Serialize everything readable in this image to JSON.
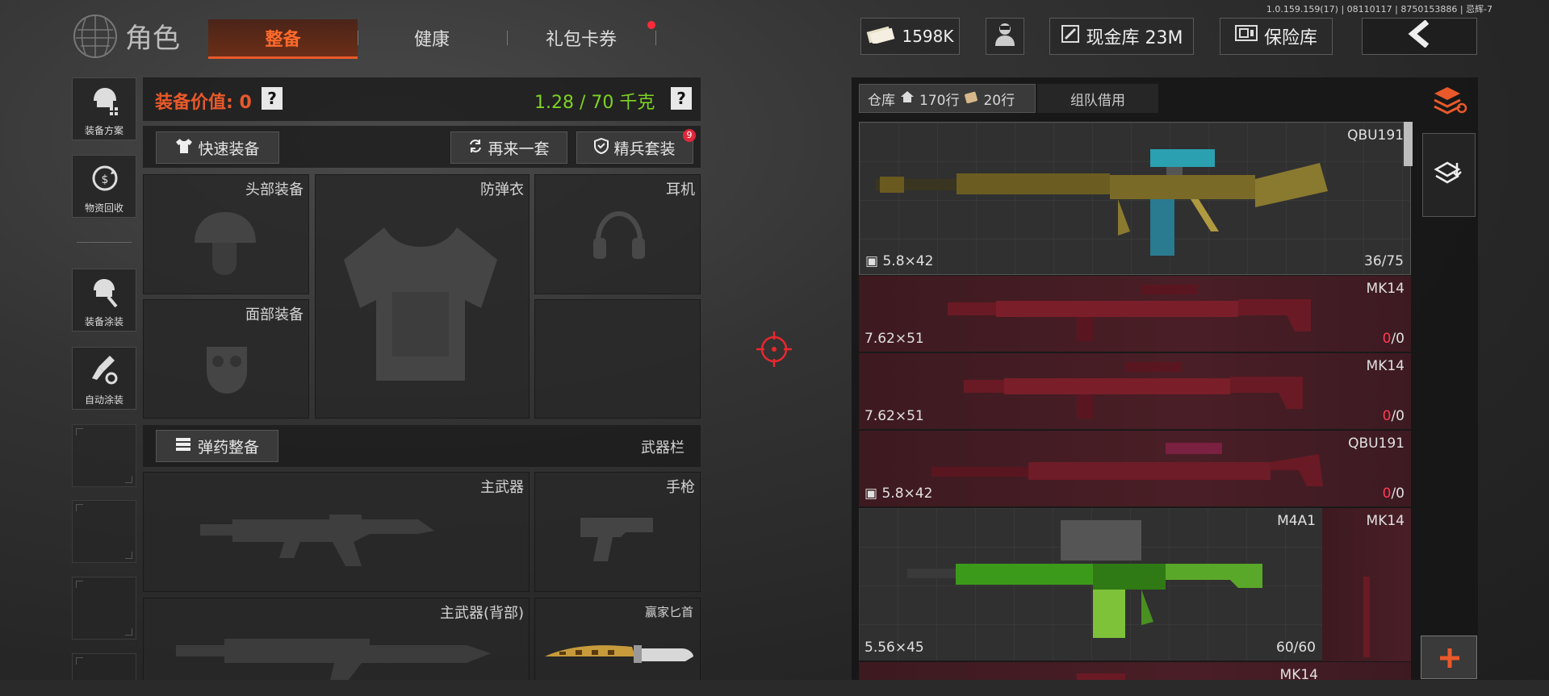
{
  "version": "1.0.159.159(17) | 08110117 | 8750153886 | 忌辉-7",
  "header": {
    "title": "角色",
    "tabs": [
      {
        "label": "整备",
        "active": true
      },
      {
        "label": "健康",
        "active": false
      },
      {
        "label": "礼包卡券",
        "active": false
      }
    ],
    "currency": "1598K",
    "cash_vault": "现金库 23M",
    "safe_vault": "保险库"
  },
  "sidebar": {
    "items": [
      {
        "label": "装备方案",
        "icon": "loadout-icon"
      },
      {
        "label": "物资回收",
        "icon": "recycle-icon"
      },
      {
        "label": "装备涂装",
        "icon": "skin-icon"
      },
      {
        "label": "自动涂装",
        "icon": "auto-paint-icon"
      }
    ]
  },
  "equipment": {
    "value_label": "装备价值: 0",
    "help": "?",
    "weight": "1.28 / 70 千克",
    "quick_equip": "快速装备",
    "again": "再来一套",
    "elite": "精兵套装",
    "elite_badge": "9",
    "slots": {
      "head": "头部装备",
      "armor": "防弹衣",
      "headset": "耳机",
      "face": "面部装备",
      "primary": "主武器",
      "pistol": "手枪",
      "primary_back": "主武器(背部)",
      "knife": "赢家匕首"
    },
    "ammo_button": "弹药整备",
    "weapon_bar": "武器栏"
  },
  "storage": {
    "tab_warehouse": "仓库",
    "rows_home": "170行",
    "rows_bag": "20行",
    "tab_team": "组队借用",
    "items": [
      {
        "name": "QBU191",
        "caliber": "5.8×42",
        "count": "36/75",
        "style": "gray"
      },
      {
        "name": "MK14",
        "caliber": "7.62×51",
        "count_a": "0",
        "count_b": "/0",
        "style": "red"
      },
      {
        "name": "MK14",
        "caliber": "7.62×51",
        "count_a": "0",
        "count_b": "/0",
        "style": "red"
      },
      {
        "name": "QBU191",
        "caliber": "5.8×42",
        "count_a": "0",
        "count_b": "/0",
        "style": "red"
      },
      {
        "name": "M4A1",
        "caliber": "5.56×45",
        "count": "60/60",
        "style": "gray"
      },
      {
        "name": "MK14",
        "style": "red"
      },
      {
        "name": "MK14",
        "style": "red"
      }
    ]
  },
  "colors": {
    "accent": "#e9592a",
    "weight_green": "#7ed321",
    "danger": "#ff3c50"
  }
}
